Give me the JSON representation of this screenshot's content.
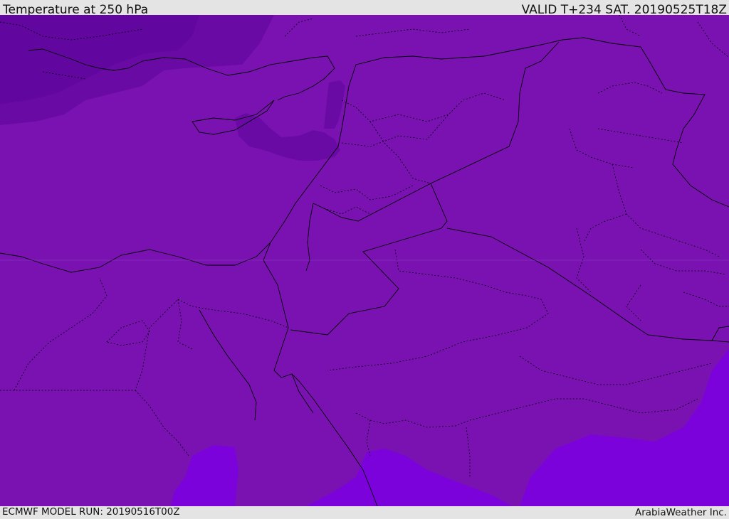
{
  "header": {
    "title": "Temperature at 250 hPa",
    "valid": "VALID T+234 SAT. 20190525T18Z"
  },
  "footer": {
    "model_run": "ECMWF MODEL RUN: 20190516T00Z",
    "credit": "ArabiaWeather Inc."
  },
  "map": {
    "colors": {
      "base": "#7a12b2",
      "cold": "#6a0aa5",
      "colder": "#6206a0",
      "warm": "#7c02dc",
      "boundary": "#000000"
    }
  }
}
